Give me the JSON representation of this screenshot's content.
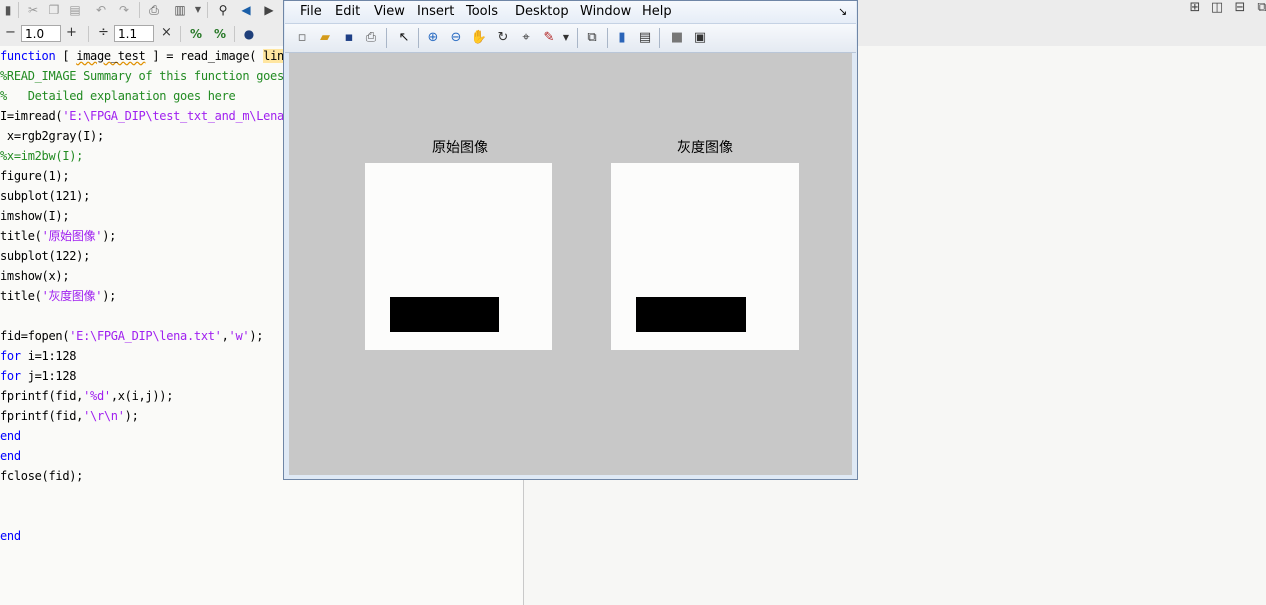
{
  "editor": {
    "cellbar": {
      "minus_label": "−",
      "value1": "1.0",
      "plus_label": "+",
      "divide_label": "÷",
      "value2": "1.1",
      "times_label": "×"
    },
    "code_lines": [
      {
        "parts": [
          {
            "t": "function",
            "c": "kw"
          },
          {
            "t": " [ "
          },
          {
            "t": "image_test",
            "c": "squig"
          },
          {
            "t": " ] = read_image( "
          },
          {
            "t": "lin",
            "c": "hl"
          }
        ]
      },
      {
        "parts": [
          {
            "t": "%READ_IMAGE Summary of this function goes here",
            "c": "cm"
          }
        ]
      },
      {
        "parts": [
          {
            "t": "%   Detailed explanation goes here",
            "c": "cm"
          }
        ]
      },
      {
        "parts": [
          {
            "t": "I=imread("
          },
          {
            "t": "'E:\\FPGA_DIP\\test_txt_and_m\\Lena.jpg'",
            "c": "str"
          },
          {
            "t": ");"
          }
        ]
      },
      {
        "parts": [
          {
            "t": " x=rgb2gray(I);"
          }
        ]
      },
      {
        "parts": [
          {
            "t": "%x=im2bw(I);",
            "c": "cm"
          }
        ]
      },
      {
        "parts": [
          {
            "t": "figure(1);"
          }
        ]
      },
      {
        "parts": [
          {
            "t": "subplot(121);"
          }
        ]
      },
      {
        "parts": [
          {
            "t": "imshow(I);"
          }
        ]
      },
      {
        "parts": [
          {
            "t": "title("
          },
          {
            "t": "'原始图像'",
            "c": "str"
          },
          {
            "t": ");"
          }
        ]
      },
      {
        "parts": [
          {
            "t": "subplot(122);"
          }
        ]
      },
      {
        "parts": [
          {
            "t": "imshow(x);"
          }
        ]
      },
      {
        "parts": [
          {
            "t": "title("
          },
          {
            "t": "'灰度图像'",
            "c": "str"
          },
          {
            "t": ");"
          }
        ]
      },
      {
        "parts": [
          {
            "t": ""
          }
        ]
      },
      {
        "parts": [
          {
            "t": "fid=fopen("
          },
          {
            "t": "'E:\\FPGA_DIP\\lena.txt'",
            "c": "str"
          },
          {
            "t": ","
          },
          {
            "t": "'w'",
            "c": "str"
          },
          {
            "t": ");"
          }
        ]
      },
      {
        "parts": [
          {
            "t": "for",
            "c": "kw"
          },
          {
            "t": " i=1:128"
          }
        ]
      },
      {
        "parts": [
          {
            "t": "for",
            "c": "kw"
          },
          {
            "t": " j=1:128"
          }
        ]
      },
      {
        "parts": [
          {
            "t": "fprintf(fid,"
          },
          {
            "t": "'%d'",
            "c": "str"
          },
          {
            "t": ",x(i,j));"
          }
        ]
      },
      {
        "parts": [
          {
            "t": "fprintf(fid,"
          },
          {
            "t": "'\\r\\n'",
            "c": "str"
          },
          {
            "t": ");"
          }
        ]
      },
      {
        "parts": [
          {
            "t": "end",
            "c": "kw"
          }
        ]
      },
      {
        "parts": [
          {
            "t": "end",
            "c": "kw"
          }
        ]
      },
      {
        "parts": [
          {
            "t": "fclose(fid);"
          }
        ]
      },
      {
        "parts": [
          {
            "t": ""
          }
        ]
      },
      {
        "parts": [
          {
            "t": ""
          }
        ]
      },
      {
        "parts": [
          {
            "t": "end",
            "c": "kw"
          }
        ]
      }
    ]
  },
  "figure": {
    "menu": [
      "File",
      "Edit",
      "View",
      "Insert",
      "Tools",
      "Desktop",
      "Window",
      "Help"
    ],
    "dock_arrow": "↘",
    "subplots": [
      {
        "title": "原始图像"
      },
      {
        "title": "灰度图像"
      }
    ]
  },
  "colors": {
    "keyword": "#0000ff",
    "string": "#a020f0",
    "comment": "#228b22",
    "canvas": "#c8c8c8"
  }
}
